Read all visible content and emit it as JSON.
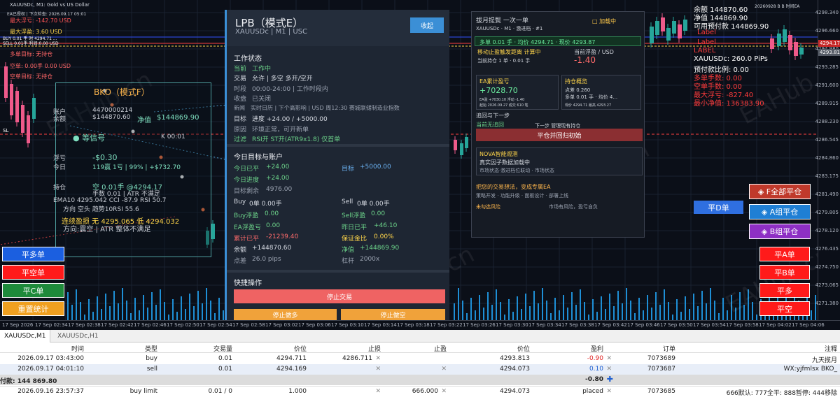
{
  "chart_header": {
    "symbol": "XAUUSDc, M1:  Gold vs US Dollar",
    "ea_line": "EA已授权 | 下次检查: 2026.09.17 05:01",
    "max_float_loss": "最大浮亏:  -142.70  USD",
    "max_float_profit": "最大浮盈:  3.60  USD",
    "buy_line": "BUY 0.01 手 时 4294.71 ...",
    "sell_line": "SELL 0.01手 利润:0.00  USD",
    "long_target": "多单目标:  无持仓",
    "short_line": "空单:  0.00手  0.00  USD",
    "short_target": "空单目标:  无持仓",
    "watermark": "EAHub.cn",
    "top_right_date": "20260928 B B 时间EA",
    "sl_mark": "SL"
  },
  "bko": {
    "title": "BKO（模式F）",
    "account_label": "账户",
    "account_value": "4470000214",
    "balance_label": "余额",
    "balance_value": "$144870.60",
    "equity_label": "净值",
    "equity_value": "$144869.90",
    "wait_signal": "等信号",
    "k_value": "K 00:01",
    "float_label": "浮亏",
    "float_value": "-$0.30",
    "today_label": "今日",
    "today_value": "119赢  1亏 | 99% | +$732.70",
    "hold_label": "持仓",
    "hold_value": "空 0.01手 @4294.17",
    "lots_line": "手数 0.01 | ATR 不满足",
    "ema_line": "EMA10 4295.042  CCI -87.9  RSI 50.7",
    "dir_line": "方向 空头     趋势10RSI 55.6",
    "guard_line": "连续盈损  无  4295.065 低 4294.032",
    "dir2_line": "方向:震空 | ATR 整体不满足"
  },
  "lpb": {
    "title": "LPB（模式E）",
    "subtitle": "XAUUSDc  |  M1  |  USC",
    "collapse_label": "收起",
    "status_title": "工作状态",
    "current_label": "当前",
    "current_value": "工作中",
    "trade_label": "交易",
    "trade_value": "允许 | 多空 多开/空开",
    "period_label": "时段",
    "period_value": "00:00-24:00 | 工作时段内",
    "close_label": "收盘",
    "close_value": "已关闭",
    "news_label": "新闻",
    "news_value": "实时日历 | 下个高影响 | USD 周12:30 赛城联储制造业指数",
    "target_label": "目标",
    "target_value": "进度 +24.00 / +5000.00",
    "reason_label": "原因",
    "reason_value": "环境正常，可开新单",
    "filter_label": "过滤",
    "filter_value": "RSI开 ST开(ATR9x1.8) 仅首单",
    "today_title": "今日目标与账户",
    "today_closed_label": "今日已平",
    "today_closed_value": "+24.00",
    "goal_label": "目标",
    "goal_value": "+5000.00",
    "today_progress_label": "今日进度",
    "today_progress_value": "+24.00",
    "remain_label": "目标剩余",
    "remain_value": "4976.00",
    "buy_label": "Buy",
    "buy_value": "0单  0.00手",
    "sell_label": "Sell",
    "sell_value": "0单  0.00手",
    "buy_float_label": "Buy浮盈",
    "buy_float_value": "0.00",
    "sell_float_label": "Sell浮盈",
    "sell_float_value": "0.00",
    "ea_float_label": "EA浮盈亏",
    "ea_float_value": "0.00",
    "yesterday_label": "昨日已平",
    "yesterday_value": "+46.10",
    "total_label": "累计已平",
    "total_value": "-21239.40",
    "margin_label": "保证金比",
    "margin_value": "0.00%",
    "bal_label": "余额",
    "bal_value": "+144870.60",
    "eq_label": "净值",
    "eq_value": "+144869.90",
    "spread_label": "点差",
    "spread_value": "26.0 pips",
    "lever_label": "杠杆",
    "lever_value": "2000x",
    "quick_title": "快捷操作",
    "stop_trade": "停止交易",
    "stop_long": "停止做多",
    "stop_short": "停止做空"
  },
  "rp": {
    "title": "拔月提鬓  一次一单",
    "loaded": "□ 加载中",
    "sub": "XAUUSDc  ·  M1  ·  激进档  ·  #1",
    "long_line": "多单  0.01 手   ·  均价  4294.71   ·   现价  4293.87",
    "move_label": "移动止盈触发距离  计算中",
    "current_profit_label": "当前浮盈 / USD",
    "current_profit": "-1.40",
    "lots_line": "当前持仓 1 单  ·  0.01 手",
    "ea_profit_title": "EA累计盈亏",
    "ea_profit_value": "+7028.70",
    "ea_stats": "EA盈 +7030.10  浮动 -1.40",
    "ea_date": "起始 2026.09.27  成交 610 笔",
    "hold_title": "持仓概览",
    "hold_points": "点差  0.260",
    "hold_long": "多单  0.01 手  ·  均价  4...",
    "hold_price": "现价 4294.71  最高 4293.27",
    "trace": "追回与下一步",
    "no_trace": "当前无追回",
    "next_step": "下一步 管理现有持仓",
    "close_btn": "平仓并回归初始",
    "nova_title": "NOVA智能观测",
    "nova_status": "真实因子数据加载中",
    "nova_sub": "市场状态·激进档位联动 · 市场状态",
    "idea_title": "把您的交易想法，变成专属EA",
    "idea_sub": "策略开发 · 功能升级 · 面板设计 · 部署上线",
    "risk_warn": "未勾选风险",
    "risk_text": "市场有风险，盈亏自负"
  },
  "right_info": {
    "balance": "余额  144870.60",
    "equity": "净值  144869.90",
    "free_margin": "可用预付款  144869.90",
    "label1": "Label",
    "label2": "Label",
    "label3": "LABEL",
    "spread": "XAUUSDc: 260.0 PiPs",
    "margin_ratio": "预付款比例: 0.00",
    "long_lots": "多单手数: 0.00",
    "short_lots": "空单手数: 0.00",
    "max_loss": "最大浮亏: -827.40",
    "min_equity": "最小净值: 136383.90"
  },
  "buttons": {
    "f_close_all": "◈ F全部平仓",
    "a_close": "◈ A组平仓",
    "b_close": "◈ B组平仓",
    "close_d": "平D单",
    "close_a_single": "平A单",
    "close_b_single": "平B单",
    "long": "平多",
    "short": "平空",
    "close_long_single": "平多单",
    "close_short_single": "平空单",
    "close_c_single": "平C单",
    "reset_stats": "重置统计"
  },
  "axis": {
    "y_ticks": [
      "4298.340",
      "4296.660",
      "4294.980",
      "4293.285",
      "4291.600",
      "4289.915",
      "4288.230",
      "4286.545",
      "4284.860",
      "4283.175",
      "4281.490",
      "4279.805",
      "4278.120",
      "4276.435",
      "4274.750",
      "4273.065",
      "4271.380"
    ],
    "y_tag_ask": "4294.171",
    "y_tag_bid": "4293.813",
    "x_ticks": [
      "17 Sep 2026",
      "17 Sep 02:34",
      "17 Sep 02:38",
      "17 Sep 02:42",
      "17 Sep 02:46",
      "17 Sep 02:50",
      "17 Sep 02:54",
      "17 Sep 02:58",
      "17 Sep 03:02",
      "17 Sep 03:06",
      "17 Sep 03:10",
      "17 Sep 03:14",
      "17 Sep 03:18",
      "17 Sep 03:22",
      "17 Sep 03:26",
      "17 Sep 03:30",
      "17 Sep 03:34",
      "17 Sep 03:38",
      "17 Sep 03:42",
      "17 Sep 03:46",
      "17 Sep 03:50",
      "17 Sep 03:54",
      "17 Sep 03:58",
      "17 Sep 04:02",
      "17 Sep 04:06"
    ]
  },
  "tabs": [
    "XAUUSDc,M1",
    "XAUUSDc,H1"
  ],
  "table": {
    "headers": [
      "时间",
      "类型",
      "交易量",
      "价位",
      "止损",
      "止盈",
      "价位",
      "盈利",
      "订单",
      "注释"
    ],
    "rows": [
      {
        "time": "2026.09.17 03:43:00",
        "type": "buy",
        "volume": "0.01",
        "price": "4294.711",
        "sl": "4286.711",
        "tp": "",
        "cur": "4293.813",
        "profit": "-0.90",
        "order": "7073689",
        "comment": "九天揽月"
      },
      {
        "time": "2026.09.17 04:01:10",
        "type": "sell",
        "volume": "0.01",
        "price": "4294.169",
        "sl": "",
        "tp": "",
        "cur": "4294.073",
        "profit": "0.10",
        "order": "7073687",
        "comment": "WX:yjfmlsx BKO_"
      }
    ],
    "summary_label": "付款: 144 869.80",
    "summary_value": "-0.80",
    "pending": {
      "time": "2026.09.16 23:57:37",
      "type": "buy limit",
      "volume": "0.01 / 0",
      "price": "1.000",
      "sl": "",
      "tp": "666.000",
      "cur": "4294.073",
      "profit": "placed",
      "order": "7073685",
      "comment": "666默认: 777全平: 888暂停: 444移除"
    }
  },
  "colors": {
    "bull": "#26a69a",
    "bear": "#ef5a8a",
    "accent": "#3b8fd6",
    "red": "#ff3b3b",
    "green": "#2ecc71"
  }
}
